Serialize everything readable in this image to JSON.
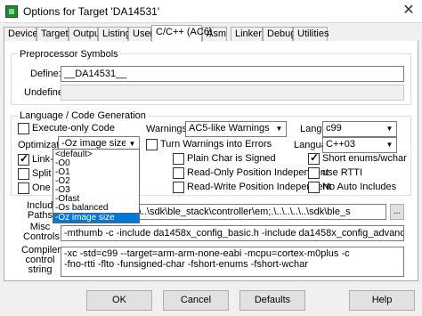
{
  "window": {
    "title": "Options for Target 'DA14531'",
    "close_glyph": "✕"
  },
  "tabs": [
    "Device",
    "Target",
    "Output",
    "Listing",
    "User",
    "C/C++ (AC6)",
    "Asm",
    "Linker",
    "Debug",
    "Utilities"
  ],
  "active_tab": "C/C++ (AC6)",
  "preprocessor": {
    "title": "Preprocessor Symbols",
    "define_label": "Define:",
    "define_value": "__DA14531__",
    "undefine_label": "Undefine:",
    "undefine_value": ""
  },
  "codegen": {
    "title": "Language / Code Generation",
    "execute_only": {
      "label": "Execute-only Code",
      "checked": false
    },
    "warnings_label": "Warnings:",
    "warnings_value": "AC5-like Warnings",
    "language_c_label": "Language C:",
    "language_c_value": "c99",
    "optimization_label": "Optimization:",
    "optimization_value": "-Oz image size",
    "turn_warnings": {
      "label": "Turn Warnings into Errors",
      "checked": false
    },
    "language_cpp_label": "Language C++:",
    "language_cpp_value": "C++03",
    "link_time": {
      "label": "Link-Time O",
      "checked": true
    },
    "plain_char": {
      "label": "Plain Char is Signed",
      "checked": false
    },
    "short_enums": {
      "label": "Short enums/wchar",
      "checked": true
    },
    "split_load": {
      "label": "Split Load",
      "checked": false
    },
    "ro_pi": {
      "label": "Read-Only Position Independent",
      "checked": false
    },
    "use_rtti": {
      "label": "use RTTI",
      "checked": false
    },
    "one_elf": {
      "label": "One ELF S",
      "checked": false
    },
    "rw_pi": {
      "label": "Read-Write Position Independent",
      "checked": false
    },
    "no_auto_includes": {
      "label": "No Auto Includes",
      "checked": false
    }
  },
  "optimization_dropdown": {
    "options": [
      "<default>",
      "-O0",
      "-O1",
      "-O2",
      "-O3",
      "-Ofast",
      "-Os balanced",
      "-Oz image size"
    ],
    "selected": "-Oz image size"
  },
  "include_paths": {
    "label_line1": "Include",
    "label_line2": "Paths",
    "value": "odules\\api;.\\..\\..\\..\\..\\sdk\\ble_stack\\controller\\em;.\\..\\..\\..\\..\\sdk\\ble_s",
    "browse_label": "..."
  },
  "misc_controls": {
    "label_line1": "Misc",
    "label_line2": "Controls",
    "value": "-mthumb -c -include da1458x_config_basic.h -include da1458x_config_advanced.h -include user_config.h"
  },
  "compiler_string": {
    "label_line1": "Compiler",
    "label_line2": "control",
    "label_line3": "string",
    "line1": "-xc -std=c99 --target=arm-arm-none-eabi -mcpu=cortex-m0plus -c",
    "line2": "-fno-rtti -flto -funsigned-char -fshort-enums -fshort-wchar"
  },
  "buttons": {
    "ok": "OK",
    "cancel": "Cancel",
    "defaults": "Defaults",
    "help": "Help"
  }
}
